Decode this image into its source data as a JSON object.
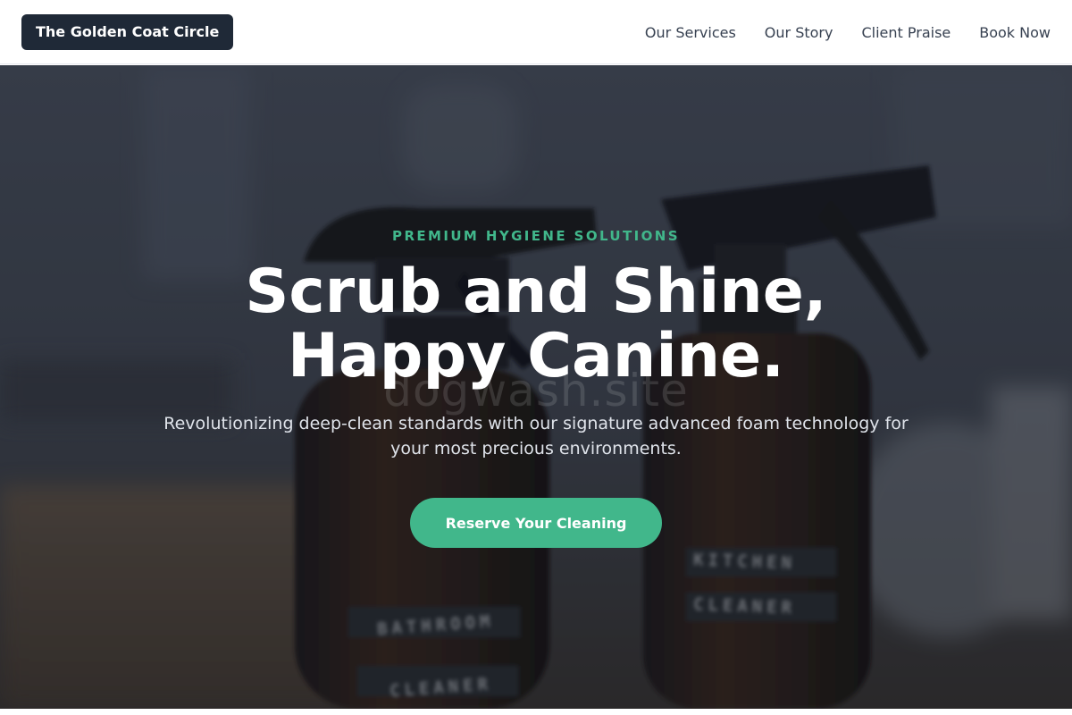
{
  "header": {
    "brand": "The Golden Coat Circle",
    "nav": [
      {
        "label": "Our Services"
      },
      {
        "label": "Our Story"
      },
      {
        "label": "Client Praise"
      },
      {
        "label": "Book Now"
      }
    ]
  },
  "hero": {
    "eyebrow": "PREMIUM HYGIENE SOLUTIONS",
    "headline_line1": "Scrub and Shine,",
    "headline_line2": "Happy Canine.",
    "subtitle": "Revolutionizing deep-clean standards with our signature advanced foam technology for your most precious environments.",
    "cta_label": "Reserve Your Cleaning",
    "watermark": "dogwash.site",
    "photo": {
      "subject": "two amber spray bottles",
      "bottle_left_label": [
        "BATHROOM",
        "CLEANER"
      ],
      "bottle_right_label": [
        "KITCHEN",
        "CLEANER"
      ]
    }
  },
  "colors": {
    "brand_bg": "#1f2937",
    "accent": "#41b78b",
    "nav_text": "#374151"
  }
}
